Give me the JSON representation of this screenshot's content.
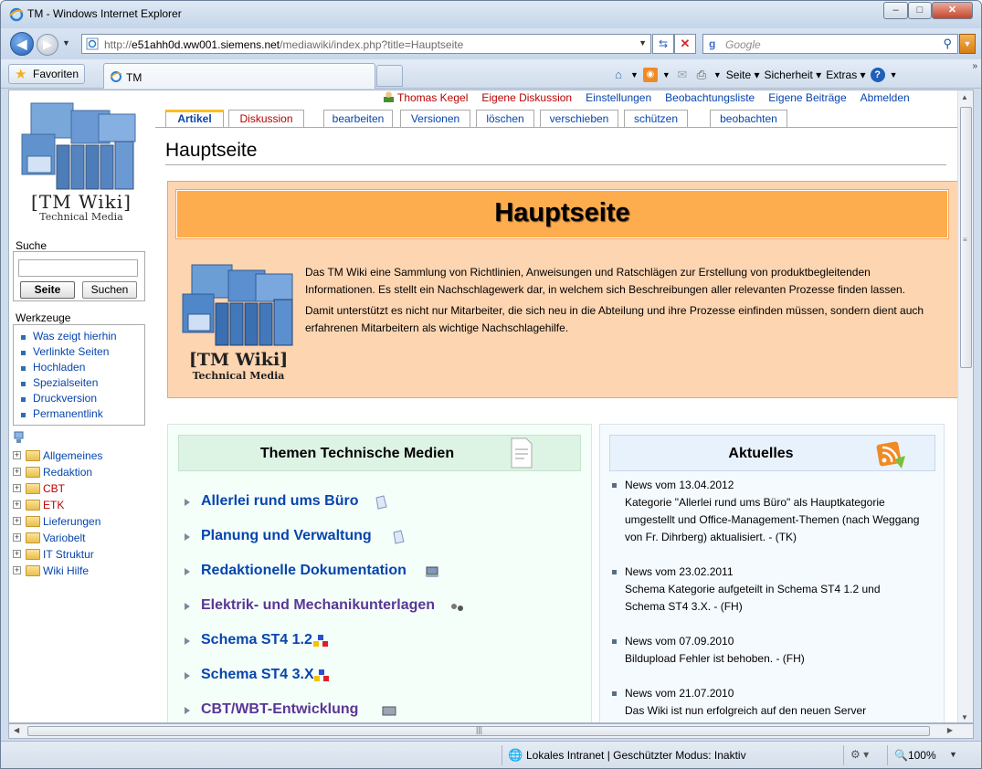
{
  "window": {
    "title": "TM - Windows Internet Explorer",
    "minimize": "–",
    "maximize": "□",
    "close": "✕"
  },
  "nav": {
    "address_prefix": "http://",
    "address_host": "e51ahh0d.ww001.siemens.net",
    "address_path": "/mediawiki/index.php?title=Hauptseite",
    "search_placeholder": "Google"
  },
  "favbar": {
    "favorites_label": "Favoriten",
    "tab_label": "TM",
    "commands": [
      "Seite ▾",
      "Sicherheit ▾",
      "Extras ▾"
    ]
  },
  "sidebar": {
    "logo_title": "[TM Wiki]",
    "logo_subtitle": "Technical Media",
    "search_heading": "Suche",
    "search_btn_page": "Seite",
    "search_btn_search": "Suchen",
    "tools_heading": "Werkzeuge",
    "tools": [
      "Was zeigt hierhin",
      "Verlinkte Seiten",
      "Hochladen",
      "Spezialseiten",
      "Druckversion",
      "Permanentlink"
    ],
    "tree": [
      "Allgemeines",
      "Redaktion",
      "CBT",
      "ETK",
      "Lieferungen",
      "Variobelt",
      "IT Struktur",
      "Wiki Hilfe"
    ]
  },
  "userlinks": {
    "user": "Thomas Kegel",
    "talk": "Eigene Diskussion",
    "prefs": "Einstellungen",
    "watchlist": "Beobachtungsliste",
    "contribs": "Eigene Beiträge",
    "logout": "Abmelden"
  },
  "tabs": {
    "article": "Artikel",
    "discussion": "Diskussion",
    "edit": "bearbeiten",
    "history": "Versionen",
    "delete": "löschen",
    "move": "verschieben",
    "protect": "schützen",
    "watch": "beobachten"
  },
  "page": {
    "heading": "Hauptseite",
    "intro_title": "Hauptseite",
    "intro_logo_title": "[TM Wiki]",
    "intro_logo_subtitle": "Technical Media",
    "intro_p1": "Das TM Wiki eine Sammlung von Richtlinien, Anweisungen und Ratschlägen zur Erstellung von produktbegleitenden Informationen. Es stellt ein Nachschlagewerk dar, in welchem sich Beschreibungen aller relevanten Prozesse finden lassen.",
    "intro_p2": "Damit unterstützt es nicht nur Mitarbeiter, die sich neu in die Abteilung und ihre Prozesse einfinden müssen, sondern dient auch erfahrenen Mitarbeitern als wichtige Nachschlagehilfe."
  },
  "themen": {
    "title": "Themen Technische Medien",
    "items": [
      "Allerlei rund ums Büro",
      "Planung und Verwaltung",
      "Redaktionelle Dokumentation",
      "Elektrik- und Mechanikunterlagen",
      "Schema ST4 1.2",
      "Schema ST4 3.X",
      "CBT/WBT-Entwicklung"
    ]
  },
  "aktuelles": {
    "title": "Aktuelles",
    "news": [
      {
        "date": "News vom 13.04.2012",
        "text": "Kategorie \"Allerlei rund ums Büro\" als Hauptkategorie umgestellt und Office-Management-Themen (nach Weggang von Fr. Dihrberg) aktualisiert. - (TK)"
      },
      {
        "date": "News vom 23.02.2011",
        "text": "Schema Kategorie aufgeteilt in Schema ST4 1.2 und Schema ST4 3.X. - (FH)"
      },
      {
        "date": "News vom 07.09.2010",
        "text": "Bildupload Fehler ist behoben. - (FH)"
      },
      {
        "date": "News vom 21.07.2010",
        "text": "Das Wiki ist nun erfolgreich auf den neuen Server"
      }
    ]
  },
  "status": {
    "zone": "Lokales Intranet | Geschützter Modus: Inaktiv",
    "zoom": "100%"
  }
}
